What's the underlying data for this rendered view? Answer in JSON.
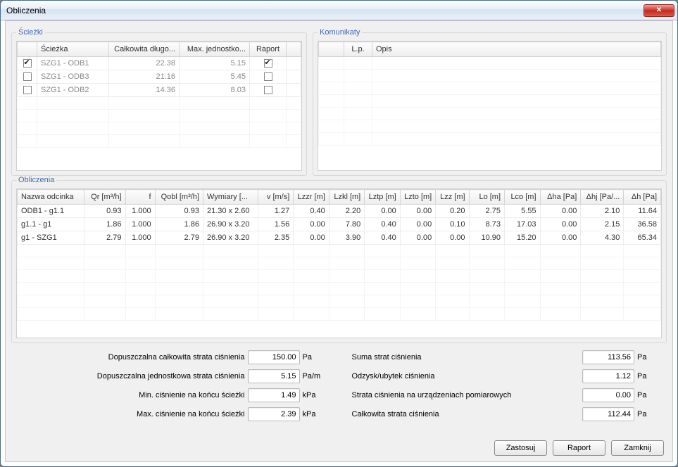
{
  "window": {
    "title": "Obliczenia"
  },
  "groups": {
    "paths": "Ścieżki",
    "messages": "Komunikaty",
    "calc": "Obliczenia"
  },
  "paths_table": {
    "headers": {
      "sel": "",
      "sciezka": "Ścieżka",
      "dlugosc": "Całkowita długo...",
      "max": "Max. jednostko...",
      "raport": "Raport"
    },
    "rows": [
      {
        "checked": true,
        "sciezka": "SZG1 - ODB1",
        "dlugosc": "22.38",
        "max": "5.15",
        "raport": true
      },
      {
        "checked": false,
        "sciezka": "SZG1 - ODB3",
        "dlugosc": "21.16",
        "max": "5.45",
        "raport": false
      },
      {
        "checked": false,
        "sciezka": "SZG1 - ODB2",
        "dlugosc": "14.36",
        "max": "8.03",
        "raport": false
      }
    ]
  },
  "messages_table": {
    "headers": {
      "lp": "L.p.",
      "opis": "Opis"
    },
    "rows": []
  },
  "calc_table": {
    "headers": {
      "nazwa": "Nazwa odcinka",
      "qr": "Qr [m³/h]",
      "f": "f",
      "qobl": "Qobl [m³/h]",
      "wymiary": "Wymiary [...",
      "v": "v [m/s]",
      "lzzr": "Lzzr [m]",
      "lzkl": "Lzkl [m]",
      "lztp": "Lztp [m]",
      "lzto": "Lzto [m]",
      "lzz": "Lzz [m]",
      "lo": "Lo [m]",
      "lco": "Lco [m]",
      "dha": "Δha [Pa]",
      "dhj": "Δhj [Pa/...",
      "dh": "Δh [Pa]"
    },
    "rows": [
      {
        "nazwa": "ODB1 - g1.1",
        "qr": "0.93",
        "f": "1.000",
        "qobl": "0.93",
        "wymiary": "21.30 x 2.60",
        "v": "1.27",
        "lzzr": "0.40",
        "lzkl": "2.20",
        "lztp": "0.00",
        "lzto": "0.00",
        "lzz": "0.20",
        "lo": "2.75",
        "lco": "5.55",
        "dha": "0.00",
        "dhj": "2.10",
        "dh": "11.64"
      },
      {
        "nazwa": "g1.1 - g1",
        "qr": "1.86",
        "f": "1.000",
        "qobl": "1.86",
        "wymiary": "26.90 x 3.20",
        "v": "1.56",
        "lzzr": "0.00",
        "lzkl": "7.80",
        "lztp": "0.40",
        "lzto": "0.00",
        "lzz": "0.10",
        "lo": "8.73",
        "lco": "17.03",
        "dha": "0.00",
        "dhj": "2.15",
        "dh": "36.58"
      },
      {
        "nazwa": "g1 - SZG1",
        "qr": "2.79",
        "f": "1.000",
        "qobl": "2.79",
        "wymiary": "26.90 x 3.20",
        "v": "2.35",
        "lzzr": "0.00",
        "lzkl": "3.90",
        "lztp": "0.40",
        "lzto": "0.00",
        "lzz": "0.00",
        "lo": "10.90",
        "lco": "15.20",
        "dha": "0.00",
        "dhj": "4.30",
        "dh": "65.34"
      }
    ]
  },
  "summary": {
    "left": [
      {
        "label": "Dopuszczalna całkowita strata ciśnienia",
        "value": "150.00",
        "unit": "Pa"
      },
      {
        "label": "Dopuszczalna jednostkowa strata ciśnienia",
        "value": "5.15",
        "unit": "Pa/m"
      },
      {
        "label": "Min. ciśnienie na końcu ścieżki",
        "value": "1.49",
        "unit": "kPa"
      },
      {
        "label": "Max. ciśnienie na końcu ścieżki",
        "value": "2.39",
        "unit": "kPa"
      }
    ],
    "right": [
      {
        "label": "Suma strat ciśnienia",
        "value": "113.56",
        "unit": "Pa"
      },
      {
        "label": "Odzysk/ubytek ciśnienia",
        "value": "1.12",
        "unit": "Pa"
      },
      {
        "label": "Strata ciśnienia na urządzeniach pomiarowych",
        "value": "0.00",
        "unit": "Pa"
      },
      {
        "label": "Całkowita strata ciśnienia",
        "value": "112.44",
        "unit": "Pa"
      }
    ]
  },
  "buttons": {
    "apply": "Zastosuj",
    "report": "Raport",
    "close": "Zamknij"
  }
}
